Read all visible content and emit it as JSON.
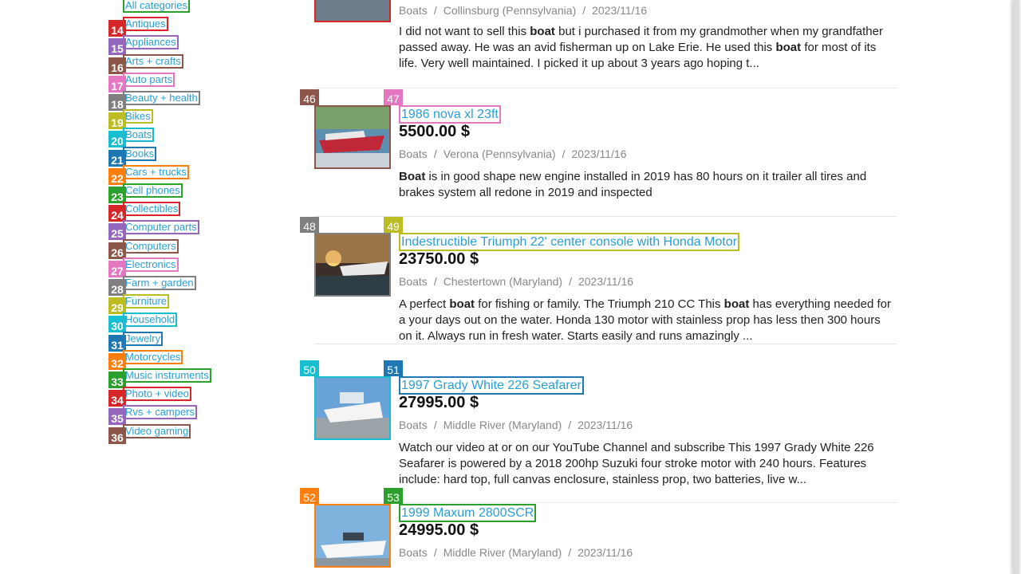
{
  "categories": [
    {
      "num": "",
      "label": "All categories",
      "badge": "",
      "box": "#2ca02c"
    },
    {
      "num": "14",
      "label": "Antiques",
      "badge": "#d62728",
      "box": "#d62728"
    },
    {
      "num": "15",
      "label": "Appliances",
      "badge": "#9467bd",
      "box": "#9467bd"
    },
    {
      "num": "16",
      "label": "Arts + crafts",
      "badge": "#8c564b",
      "box": "#8c564b"
    },
    {
      "num": "17",
      "label": "Auto parts",
      "badge": "#e377c2",
      "box": "#e377c2"
    },
    {
      "num": "18",
      "label": "Beauty + health",
      "badge": "#7f7f7f",
      "box": "#7f7f7f"
    },
    {
      "num": "19",
      "label": "Bikes",
      "badge": "#bcbd22",
      "box": "#bcbd22"
    },
    {
      "num": "20",
      "label": "Boats",
      "badge": "#17becf",
      "box": "#17becf"
    },
    {
      "num": "21",
      "label": "Books",
      "badge": "#1f77b4",
      "box": "#1f77b4"
    },
    {
      "num": "22",
      "label": "Cars + trucks",
      "badge": "#ff7f0e",
      "box": "#ff7f0e"
    },
    {
      "num": "23",
      "label": "Cell phones",
      "badge": "#2ca02c",
      "box": "#2ca02c"
    },
    {
      "num": "24",
      "label": "Collectibles",
      "badge": "#d62728",
      "box": "#d62728"
    },
    {
      "num": "25",
      "label": "Computer parts",
      "badge": "#9467bd",
      "box": "#9467bd"
    },
    {
      "num": "26",
      "label": "Computers",
      "badge": "#8c564b",
      "box": "#8c564b"
    },
    {
      "num": "27",
      "label": "Electronics",
      "badge": "#e377c2",
      "box": "#e377c2"
    },
    {
      "num": "28",
      "label": "Farm + garden",
      "badge": "#7f7f7f",
      "box": "#7f7f7f"
    },
    {
      "num": "29",
      "label": "Furniture",
      "badge": "#bcbd22",
      "box": "#bcbd22"
    },
    {
      "num": "30",
      "label": "Household",
      "badge": "#17becf",
      "box": "#17becf"
    },
    {
      "num": "31",
      "label": "Jewelry",
      "badge": "#1f77b4",
      "box": "#1f77b4"
    },
    {
      "num": "32",
      "label": "Motorcycles",
      "badge": "#ff7f0e",
      "box": "#ff7f0e"
    },
    {
      "num": "33",
      "label": "Music instruments",
      "badge": "#2ca02c",
      "box": "#2ca02c"
    },
    {
      "num": "34",
      "label": "Photo + video",
      "badge": "#d62728",
      "box": "#d62728"
    },
    {
      "num": "35",
      "label": "Rvs + campers",
      "badge": "#9467bd",
      "box": "#9467bd"
    },
    {
      "num": "36",
      "label": "Video gaming",
      "badge": "#8c564b",
      "box": "#8c564b"
    }
  ],
  "listings": [
    {
      "img_num": "",
      "title_num": "",
      "img_badge": "",
      "title_badge": "",
      "title": "",
      "price": "",
      "category": "Boats",
      "location": "Collinsburg (Pennsylvania)",
      "date": "2023/11/16",
      "desc_parts": [
        "I did not want to sell this ",
        "boat",
        " but i purchased it from my grandmother when my grandfather passed away. He was an avid fisherman up on Lake Erie. He used this ",
        "boat",
        " for most of its life. Very well maintained. I picked it up about 3 years ago hoping t..."
      ],
      "img_box": "#d62728"
    },
    {
      "img_num": "46",
      "title_num": "47",
      "img_badge": "#8c564b",
      "title_badge": "#e377c2",
      "title": "1986 nova xl 23ft",
      "price": "5500.00 $",
      "category": "Boats",
      "location": "Verona (Pennsylvania)",
      "date": "2023/11/16",
      "desc_parts": [
        "",
        "Boat",
        " is in good shape new engine installed in 2019 has 80 hours on it trailer all tires and brakes system all redone in 2019 and inspected"
      ],
      "img_box": "#8c564b",
      "title_box": "#e377c2"
    },
    {
      "img_num": "48",
      "title_num": "49",
      "img_badge": "#7f7f7f",
      "title_badge": "#bcbd22",
      "title": "Indestructible Triumph 22' center console with Honda Motor",
      "price": "23750.00 $",
      "category": "Boats",
      "location": "Chestertown (Maryland)",
      "date": "2023/11/16",
      "desc_parts": [
        "A perfect ",
        "boat",
        " for fishing or family. The Triumph 210 CC This ",
        "boat",
        " has everything needed for a your days out on the water. Honda 130 motor with stainless prop has less then 300 hours on it. Always run in fresh water. Starts easily and runs amazingly ..."
      ],
      "img_box": "#7f7f7f",
      "title_box": "#bcbd22"
    },
    {
      "img_num": "50",
      "title_num": "51",
      "img_badge": "#17becf",
      "title_badge": "#1f77b4",
      "title": "1997 Grady White 226 Seafarer",
      "price": "27995.00 $",
      "category": "Boats",
      "location": "Middle River (Maryland)",
      "date": "2023/11/16",
      "desc_parts": [
        "Watch our video at or on our YouTube Channel and subscribe This 1997 Grady White 226 Seafarer is powered by a 2018 200hp Suzuki four stroke motor with 240 hours. Features include: hard top, full canvas enclosure, stainless prop, two batteries, live w..."
      ],
      "img_box": "#17becf",
      "title_box": "#1f77b4"
    },
    {
      "img_num": "52",
      "title_num": "53",
      "img_badge": "#ff7f0e",
      "title_badge": "#2ca02c",
      "title": "1999 Maxum 2800SCR",
      "price": "24995.00 $",
      "category": "Boats",
      "location": "Middle River (Maryland)",
      "date": "2023/11/16",
      "desc_parts": [],
      "img_box": "#ff7f0e",
      "title_box": "#2ca02c"
    }
  ],
  "icons": {
    "separator": "/"
  }
}
